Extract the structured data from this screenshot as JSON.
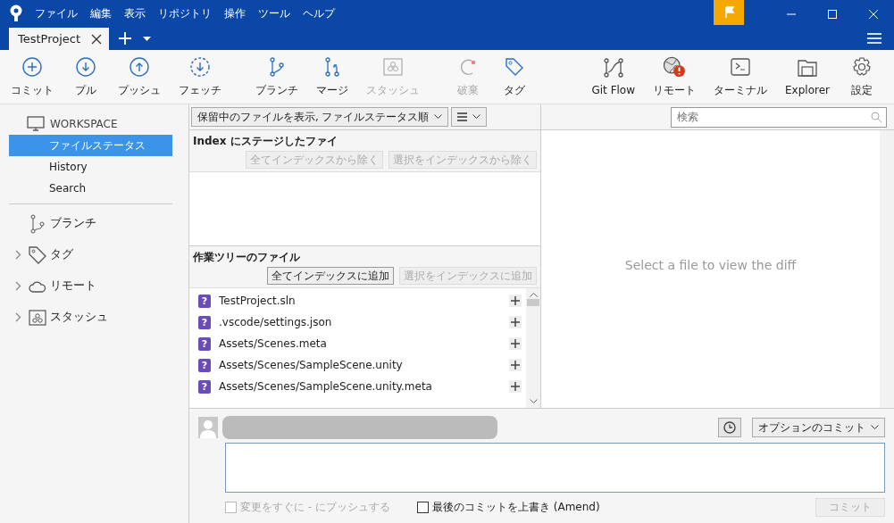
{
  "menu": [
    "ファイル",
    "編集",
    "表示",
    "リポジトリ",
    "操作",
    "ツール",
    "ヘルプ"
  ],
  "tabs": [
    {
      "label": "TestProject",
      "selected": true
    }
  ],
  "toolbar_left": [
    {
      "label": "コミット",
      "disabled": false
    },
    {
      "label": "プル",
      "disabled": false
    },
    {
      "label": "プッシュ",
      "disabled": false
    },
    {
      "label": "フェッチ",
      "disabled": false
    },
    {
      "label": "ブランチ",
      "disabled": false
    },
    {
      "label": "マージ",
      "disabled": false
    },
    {
      "label": "スタッシュ",
      "disabled": true
    },
    {
      "label": "破棄",
      "disabled": true
    },
    {
      "label": "タグ",
      "disabled": false
    }
  ],
  "toolbar_right": [
    {
      "label": "Git Flow",
      "alert": false
    },
    {
      "label": "リモート",
      "alert": true
    },
    {
      "label": "ターミナル",
      "alert": false
    },
    {
      "label": "Explorer",
      "alert": false
    },
    {
      "label": "設定",
      "alert": false
    }
  ],
  "sidebar": {
    "workspace": "WORKSPACE",
    "items": [
      {
        "label": "ファイルステータス",
        "selected": true
      },
      {
        "label": "History",
        "selected": false
      },
      {
        "label": "Search",
        "selected": false
      }
    ],
    "sections": [
      {
        "label": "ブランチ"
      },
      {
        "label": "タグ",
        "expanded": false
      },
      {
        "label": "リモート",
        "expanded": false
      },
      {
        "label": "スタッシュ",
        "expanded": false
      }
    ]
  },
  "filter": {
    "value": "保留中のファイルを表示, ファイルステータス順"
  },
  "search": {
    "placeholder": "検索"
  },
  "staged": {
    "title": "Index にステージしたファイ",
    "buttons": [
      {
        "label": "全てインデックスから除く",
        "disabled": true
      },
      {
        "label": "選択をインデックスから除く",
        "disabled": true
      }
    ]
  },
  "unstaged": {
    "title": "作業ツリーのファイル",
    "buttons": [
      {
        "label": "全てインデックスに追加",
        "disabled": false
      },
      {
        "label": "選択をインデックスに追加",
        "disabled": true
      }
    ],
    "files": [
      {
        "status": "?",
        "path": "TestProject.sln"
      },
      {
        "status": "?",
        "path": ".vscode/settings.json"
      },
      {
        "status": "?",
        "path": "Assets/Scenes.meta"
      },
      {
        "status": "?",
        "path": "Assets/Scenes/SampleScene.unity"
      },
      {
        "status": "?",
        "path": "Assets/Scenes/SampleScene.unity.meta"
      }
    ]
  },
  "diff": {
    "message": "Select a file to view the diff"
  },
  "commit": {
    "options": "オプションのコミット",
    "push_now": {
      "label": "変更をすぐに - にプッシュする",
      "checked": false,
      "disabled": true
    },
    "amend": {
      "label": "最後のコミットを上書き (Amend)",
      "checked": false,
      "disabled": false
    },
    "button": {
      "label": "コミット",
      "disabled": true
    }
  }
}
